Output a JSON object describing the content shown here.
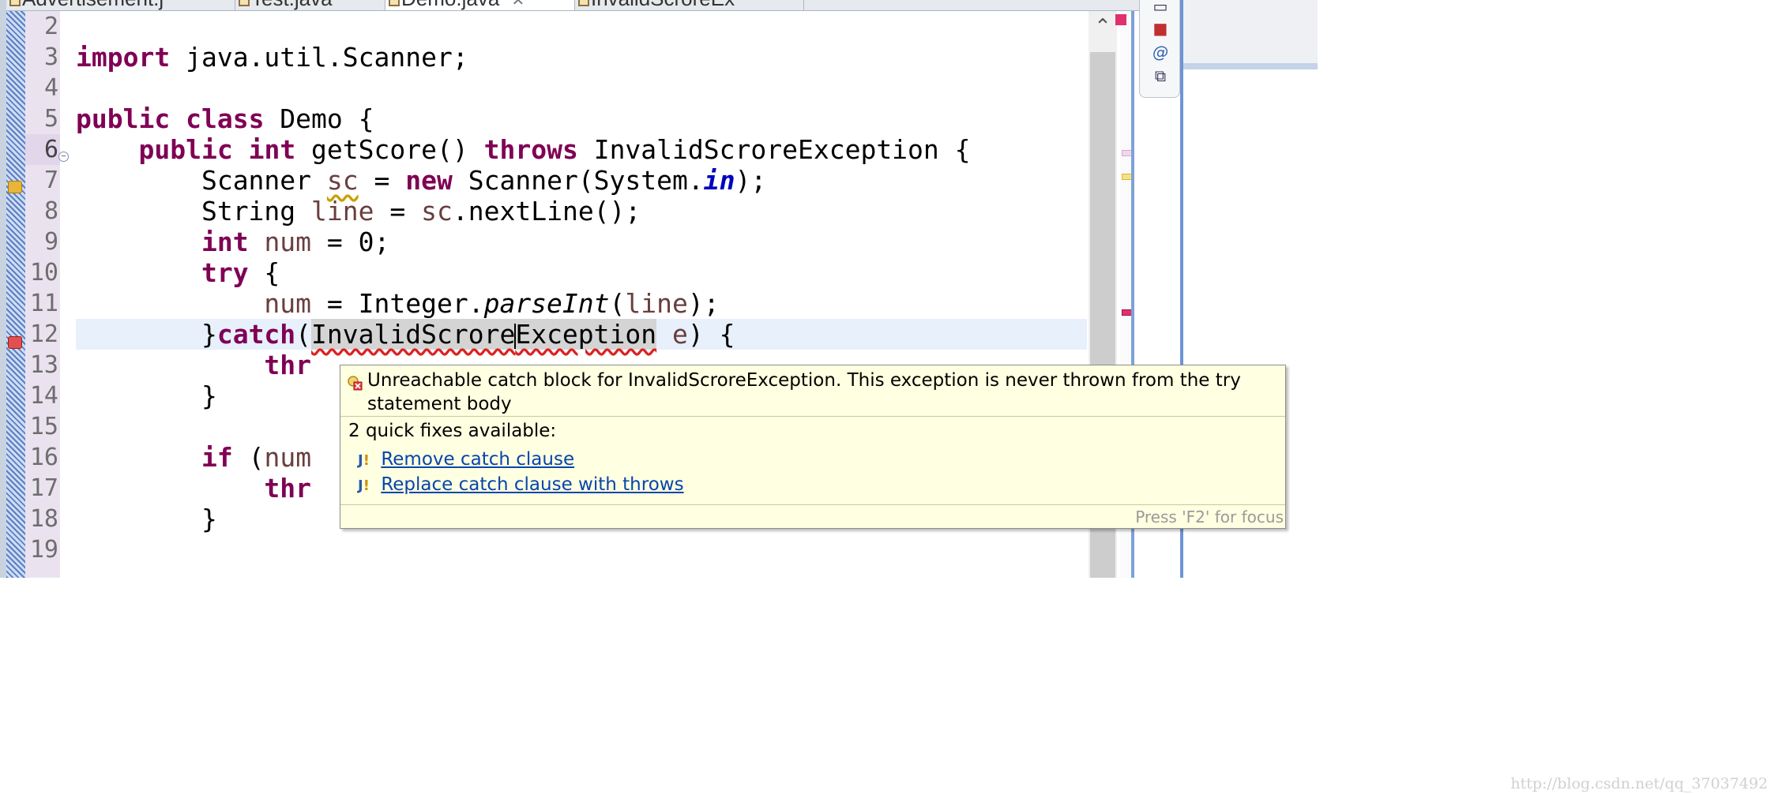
{
  "tabs": [
    {
      "label": "Advertisement.j"
    },
    {
      "label": "Test.java"
    },
    {
      "label": "Demo.java",
      "close": "✕"
    },
    {
      "label": "InvalidScroreEx"
    }
  ],
  "line_numbers": [
    "2",
    "3",
    "4",
    "5",
    "6",
    "7",
    "8",
    "9",
    "10",
    "11",
    "12",
    "13",
    "14",
    "15",
    "16",
    "17",
    "18",
    "19"
  ],
  "code": {
    "l3": {
      "kw": "import",
      "rest": " java.util.Scanner;"
    },
    "l5": {
      "kw1": "public",
      "kw2": "class",
      "rest": " Demo {"
    },
    "l6": {
      "indent": "    ",
      "kw1": "public",
      "kw2": "int",
      "mid": " getScore() ",
      "kw3": "throws",
      "rest": " InvalidScroreException {"
    },
    "l7": {
      "indent": "        ",
      "t1": "Scanner ",
      "var": "sc",
      "t2": " = ",
      "kw": "new",
      "t3": " Scanner(System.",
      "fld": "in",
      "t4": ");"
    },
    "l8": {
      "indent": "        ",
      "t1": "String ",
      "var1": "line",
      "t2": " = ",
      "var2": "sc",
      "t3": ".nextLine();"
    },
    "l9": {
      "indent": "        ",
      "kw": "int",
      "sp": " ",
      "var": "num",
      "rest": " = 0;"
    },
    "l10": {
      "indent": "        ",
      "kw": "try",
      "rest": " {"
    },
    "l11": {
      "indent": "            ",
      "var1": "num",
      "t1": " = Integer.",
      "mth": "parseInt",
      "t2": "(",
      "var2": "line",
      "t3": ");"
    },
    "l12": {
      "indent": "        ",
      "t1": "}",
      "kw": "catch",
      "t2": "(",
      "ex1": "InvalidScrore",
      "ex2": "Exception",
      "t3": " ",
      "var": "e",
      "t4": ") {"
    },
    "l13": {
      "indent": "            ",
      "kw": "thr"
    },
    "l14": {
      "indent": "        ",
      "t1": "}"
    },
    "l16": {
      "indent": "        ",
      "kw": "if",
      "t1": " (",
      "var": "num"
    },
    "l17": {
      "indent": "            ",
      "kw": "thr"
    },
    "l18": {
      "indent": "        ",
      "t1": "}"
    }
  },
  "popup": {
    "message": "Unreachable catch block for InvalidScroreException. This exception is never thrown from the try statement body",
    "fixes_heading": "2 quick fixes available:",
    "fixes": [
      {
        "label": "Remove catch clause"
      },
      {
        "label": "Replace catch clause with throws"
      }
    ],
    "focus_hint": "Press 'F2' for focus"
  },
  "side_toolbar": {
    "icons": [
      "restore-icon",
      "javadoc-icon",
      "at-icon",
      "declaration-icon"
    ]
  },
  "watermark": "http://blog.csdn.net/qq_37037492",
  "colors": {
    "keyword": "#7f0055",
    "variable": "#6a3e3e",
    "field": "#0000c0",
    "current_line": "#e8f0fc",
    "popup_bg": "#ffffe1",
    "link": "#0645ad"
  }
}
